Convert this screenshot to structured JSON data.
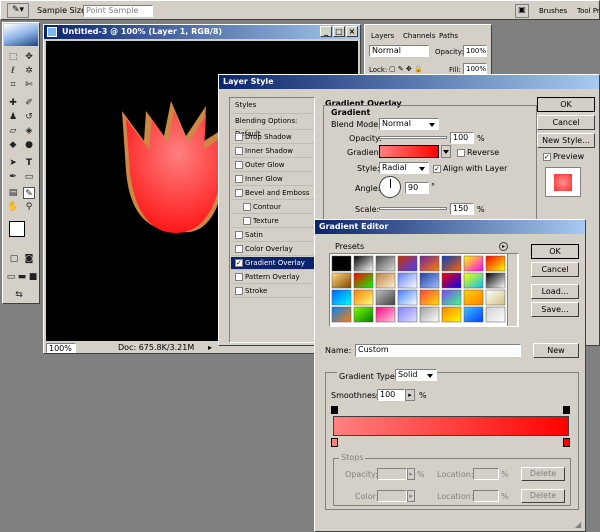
{
  "options_bar": {
    "sample_size_label": "Sample Size:",
    "sample_size_value": "Point Sample",
    "tab_brushes": "Brushes",
    "tab_toolpresets": "Tool Pr"
  },
  "document": {
    "title": "Untitled-3 @ 100% (Layer 1, RGB/8)",
    "zoom": "100%",
    "doc_info": "Doc: 675.8K/3.21M"
  },
  "layers_panel": {
    "tabs": [
      "Layers",
      "Channels",
      "Paths"
    ],
    "blend_mode": "Normal",
    "opacity_label": "Opacity:",
    "opacity_value": "100%",
    "lock_label": "Lock:",
    "fill_label": "Fill:",
    "fill_value": "100%"
  },
  "layer_style": {
    "title": "Layer Style",
    "sidebar": {
      "styles": "Styles",
      "blending": "Blending Options: Default",
      "items": [
        "Drop Shadow",
        "Inner Shadow",
        "Outer Glow",
        "Inner Glow",
        "Bevel and Emboss",
        "Contour",
        "Texture",
        "Satin",
        "Color Overlay",
        "Gradient Overlay",
        "Pattern Overlay",
        "Stroke"
      ]
    },
    "section_title": "Gradient Overlay",
    "subsection": "Gradient",
    "blend_mode_label": "Blend Mode:",
    "blend_mode_value": "Normal",
    "opacity_label": "Opacity:",
    "opacity_value": "100",
    "percent": "%",
    "gradient_label": "Gradient:",
    "reverse_label": "Reverse",
    "style_label": "Style:",
    "style_value": "Radial",
    "align_label": "Align with Layer",
    "angle_label": "Angle:",
    "angle_value": "90",
    "degree": "°",
    "scale_label": "Scale:",
    "scale_value": "150",
    "buttons": {
      "ok": "OK",
      "cancel": "Cancel",
      "new_style": "New Style...",
      "preview": "Preview"
    }
  },
  "gradient_editor": {
    "title": "Gradient Editor",
    "presets_label": "Presets",
    "buttons": {
      "ok": "OK",
      "cancel": "Cancel",
      "load": "Load...",
      "save": "Save...",
      "new": "New",
      "delete1": "Delete",
      "delete2": "Delete"
    },
    "name_label": "Name:",
    "name_value": "Custom",
    "type_label": "Gradient Type:",
    "type_value": "Solid",
    "smoothness_label": "Smoothness:",
    "smoothness_value": "100",
    "percent": "%",
    "stops_label": "Stops",
    "opacity_label": "Opacity:",
    "location_label": "Location:",
    "color_label": "Color:",
    "gradient_start": "#ff8080",
    "gradient_end": "#ff0000"
  },
  "colors": {
    "accent": "#0a246a",
    "selected": "#0a246a"
  }
}
